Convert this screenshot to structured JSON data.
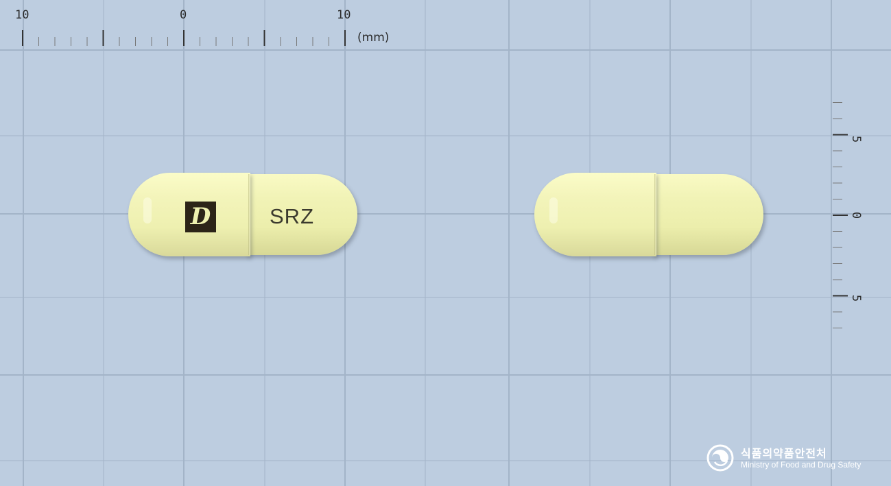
{
  "ruler_horizontal": {
    "labels": [
      "10",
      "0",
      "10"
    ],
    "unit": "(mm)"
  },
  "ruler_vertical": {
    "labels": [
      "5",
      "0",
      "5"
    ]
  },
  "capsule_front": {
    "logo_text": "D",
    "imprint": "SRZ"
  },
  "capsule_back": {
    "imprint": ""
  },
  "watermark": {
    "korean": "식품의약품안전처",
    "english": "Ministry of Food and Drug Safety"
  },
  "colors": {
    "background": "#bdcde0",
    "grid_line": "#a3b4c8",
    "capsule": "#f1f3b6",
    "logo_box": "#2c2418"
  }
}
